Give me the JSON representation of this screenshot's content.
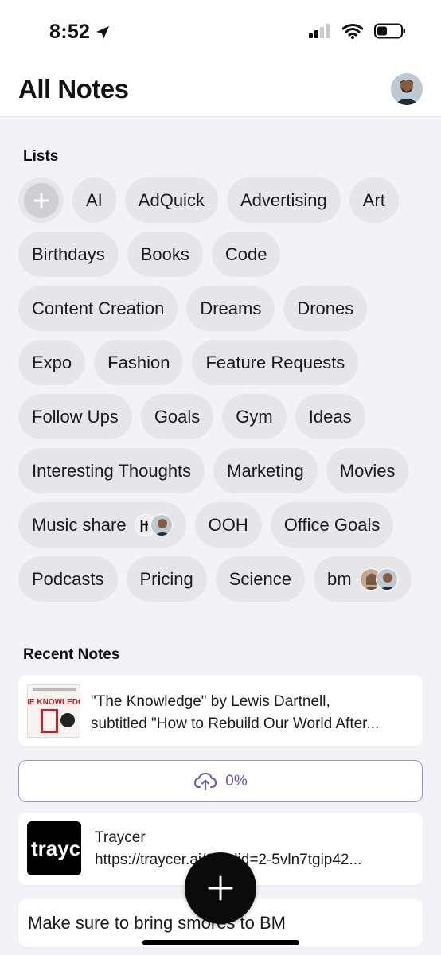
{
  "status_bar": {
    "time": "8:52"
  },
  "header": {
    "title": "All Notes"
  },
  "lists": {
    "label": "Lists",
    "items": [
      "AI",
      "AdQuick",
      "Advertising",
      "Art",
      "Birthdays",
      "Books",
      "Code",
      "Content Creation",
      "Dreams",
      "Drones",
      "Expo",
      "Fashion",
      "Feature Requests",
      "Follow Ups",
      "Goals",
      "Gym",
      "Ideas",
      "Interesting Thoughts",
      "Marketing",
      "Movies",
      "Music share",
      "OOH",
      "Office Goals",
      "Podcasts",
      "Pricing",
      "Science",
      "bm"
    ]
  },
  "recent": {
    "label": "Recent Notes",
    "notes": [
      {
        "line1": "\"The Knowledge\" by Lewis Dartnell,",
        "line2": "subtitled \"How to Rebuild Our World After...",
        "thumb_text": "THE KNOWLEDGE"
      },
      {
        "upload_progress": "0%"
      },
      {
        "line1": "Traycer",
        "line2": "https://traycer.ai/?fbclid=2-5vln7tgip42...",
        "thumb_text": "trayc"
      },
      {
        "line1": "Make sure to bring smores to BM"
      }
    ]
  },
  "colors": {
    "accent": "#6e56b5",
    "chip_bg": "#e6e6ea",
    "background": "#f2f2f7"
  }
}
